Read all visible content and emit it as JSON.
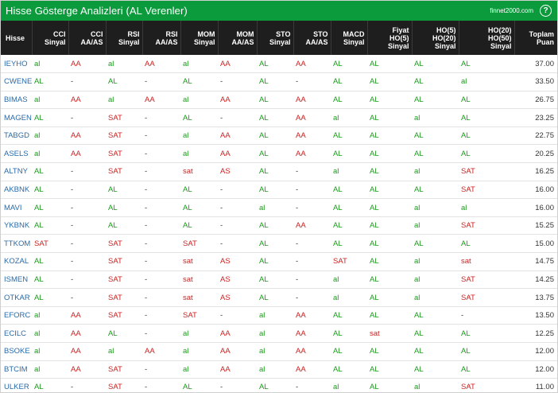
{
  "header": {
    "title": "Hisse Gösterge Analizleri (AL Verenler)",
    "brand": "finnet2000.com",
    "help": "?"
  },
  "columns": [
    {
      "lines": [
        "Hisse"
      ]
    },
    {
      "lines": [
        "CCI",
        "Sinyal"
      ]
    },
    {
      "lines": [
        "CCI",
        "AA/AS"
      ]
    },
    {
      "lines": [
        "RSI",
        "Sinyal"
      ]
    },
    {
      "lines": [
        "RSI",
        "AA/AS"
      ]
    },
    {
      "lines": [
        "MOM",
        "Sinyal"
      ]
    },
    {
      "lines": [
        "MOM",
        "AA/AS"
      ]
    },
    {
      "lines": [
        "STO",
        "Sinyal"
      ]
    },
    {
      "lines": [
        "STO",
        "AA/AS"
      ]
    },
    {
      "lines": [
        "MACD",
        "Sinyal"
      ]
    },
    {
      "lines": [
        "Fiyat",
        "HO(5)",
        "Sinyal"
      ]
    },
    {
      "lines": [
        "HO(5)",
        "HO(20)",
        "Sinyal"
      ]
    },
    {
      "lines": [
        "HO(20)",
        "HO(50)",
        "Sinyal"
      ]
    },
    {
      "lines": [
        "Toplam",
        "Puan"
      ]
    }
  ],
  "rows": [
    [
      "IEYHO",
      "al",
      "AA",
      "al",
      "AA",
      "al",
      "AA",
      "AL",
      "AA",
      "AL",
      "AL",
      "AL",
      "AL",
      "37.00"
    ],
    [
      "CWENE",
      "AL",
      "-",
      "AL",
      "-",
      "AL",
      "-",
      "AL",
      "-",
      "AL",
      "AL",
      "AL",
      "al",
      "33.50"
    ],
    [
      "BIMAS",
      "al",
      "AA",
      "al",
      "AA",
      "al",
      "AA",
      "AL",
      "AA",
      "AL",
      "AL",
      "AL",
      "AL",
      "26.75"
    ],
    [
      "MAGEN",
      "AL",
      "-",
      "SAT",
      "-",
      "AL",
      "-",
      "AL",
      "AA",
      "al",
      "AL",
      "al",
      "AL",
      "23.25"
    ],
    [
      "TABGD",
      "al",
      "AA",
      "SAT",
      "-",
      "al",
      "AA",
      "AL",
      "AA",
      "AL",
      "AL",
      "AL",
      "AL",
      "22.75"
    ],
    [
      "ASELS",
      "al",
      "AA",
      "SAT",
      "-",
      "al",
      "AA",
      "AL",
      "AA",
      "AL",
      "AL",
      "AL",
      "AL",
      "20.25"
    ],
    [
      "ALTNY",
      "AL",
      "-",
      "SAT",
      "-",
      "sat",
      "AS",
      "AL",
      "-",
      "al",
      "AL",
      "al",
      "SAT",
      "16.25"
    ],
    [
      "AKBNK",
      "AL",
      "-",
      "AL",
      "-",
      "AL",
      "-",
      "AL",
      "-",
      "AL",
      "AL",
      "AL",
      "SAT",
      "16.00"
    ],
    [
      "MAVI",
      "AL",
      "-",
      "AL",
      "-",
      "AL",
      "-",
      "al",
      "-",
      "AL",
      "AL",
      "al",
      "al",
      "16.00"
    ],
    [
      "YKBNK",
      "AL",
      "-",
      "AL",
      "-",
      "AL",
      "-",
      "AL",
      "AA",
      "AL",
      "AL",
      "al",
      "SAT",
      "15.25"
    ],
    [
      "TTKOM",
      "SAT",
      "-",
      "SAT",
      "-",
      "SAT",
      "-",
      "AL",
      "-",
      "AL",
      "AL",
      "AL",
      "AL",
      "15.00"
    ],
    [
      "KOZAL",
      "AL",
      "-",
      "SAT",
      "-",
      "sat",
      "AS",
      "AL",
      "-",
      "SAT",
      "AL",
      "al",
      "sat",
      "14.75"
    ],
    [
      "ISMEN",
      "AL",
      "-",
      "SAT",
      "-",
      "sat",
      "AS",
      "AL",
      "-",
      "al",
      "AL",
      "al",
      "SAT",
      "14.25"
    ],
    [
      "OTKAR",
      "AL",
      "-",
      "SAT",
      "-",
      "sat",
      "AS",
      "AL",
      "-",
      "al",
      "AL",
      "al",
      "SAT",
      "13.75"
    ],
    [
      "EFORC",
      "al",
      "AA",
      "SAT",
      "-",
      "SAT",
      "-",
      "al",
      "AA",
      "AL",
      "AL",
      "AL",
      "-",
      "13.50"
    ],
    [
      "ECILC",
      "al",
      "AA",
      "AL",
      "-",
      "al",
      "AA",
      "al",
      "AA",
      "AL",
      "sat",
      "AL",
      "AL",
      "12.25"
    ],
    [
      "BSOKE",
      "al",
      "AA",
      "al",
      "AA",
      "al",
      "AA",
      "al",
      "AA",
      "AL",
      "AL",
      "AL",
      "AL",
      "12.00"
    ],
    [
      "BTCIM",
      "al",
      "AA",
      "SAT",
      "-",
      "al",
      "AA",
      "al",
      "AA",
      "AL",
      "AL",
      "AL",
      "AL",
      "12.00"
    ],
    [
      "ULKER",
      "AL",
      "-",
      "SAT",
      "-",
      "AL",
      "-",
      "AL",
      "-",
      "al",
      "AL",
      "al",
      "SAT",
      "11.00"
    ]
  ],
  "colors": {
    "title_bar": "#0b9a3c",
    "header_bg": "#1e1e1e",
    "buy": "#1a9a1a",
    "sell": "#cc2222",
    "symbol": "#2a6aa8"
  }
}
